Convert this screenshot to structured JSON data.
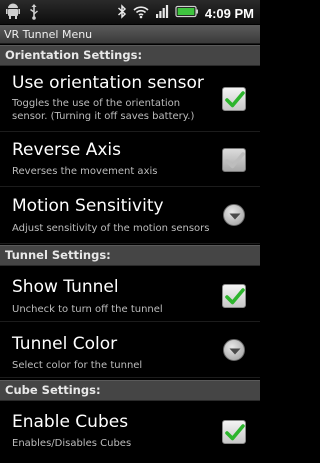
{
  "status_bar": {
    "time": "4:09",
    "ampm": "PM",
    "icons": [
      "android-icon",
      "usb-icon",
      "bluetooth-icon",
      "wifi-icon",
      "signal-icon",
      "battery-icon"
    ]
  },
  "window": {
    "title": "VR Tunnel Menu"
  },
  "sections": [
    {
      "header": "Orientation Settings:",
      "items": [
        {
          "title": "Use orientation sensor",
          "summary": "Toggles the use of the orientation sensor. (Turning it off saves battery.)",
          "widget": "checkbox",
          "checked": true,
          "enabled": true
        },
        {
          "title": "Reverse Axis",
          "summary": "Reverses the movement axis",
          "widget": "checkbox",
          "checked": true,
          "enabled": false
        },
        {
          "title": "Motion Sensitivity",
          "summary": "Adjust sensitivity of the motion sensors",
          "widget": "dropdown"
        }
      ]
    },
    {
      "header": "Tunnel Settings:",
      "items": [
        {
          "title": "Show Tunnel",
          "summary": "Uncheck to turn off the tunnel",
          "widget": "checkbox",
          "checked": true,
          "enabled": true
        },
        {
          "title": "Tunnel Color",
          "summary": "Select color for the tunnel",
          "widget": "dropdown"
        }
      ]
    },
    {
      "header": "Cube Settings:",
      "items": [
        {
          "title": "Enable Cubes",
          "summary": "Enables/Disables Cubes",
          "widget": "checkbox",
          "checked": true,
          "enabled": true
        }
      ]
    }
  ],
  "colors": {
    "check_green": "#2db52d",
    "check_disabled": "#b8b8b8",
    "section_bg": "#454545",
    "background": "#000000"
  }
}
